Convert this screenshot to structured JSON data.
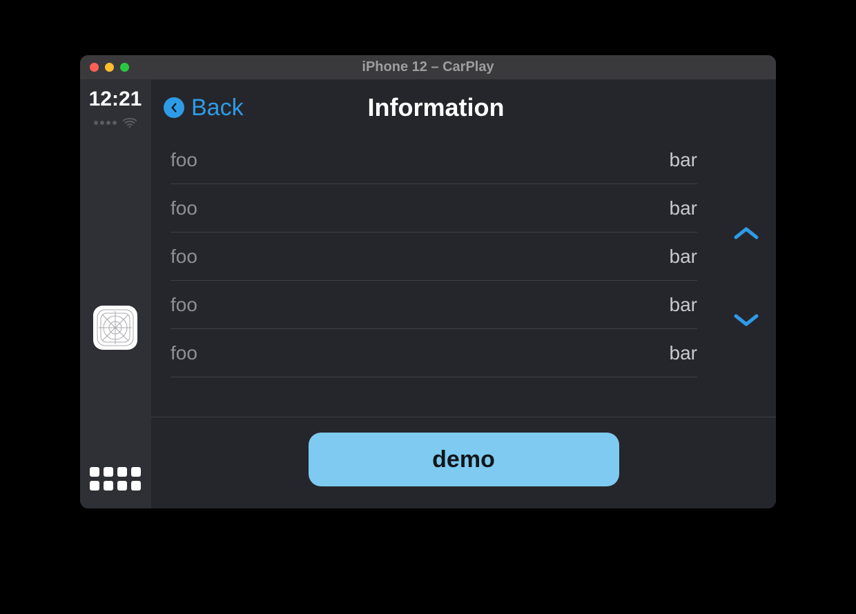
{
  "window": {
    "title": "iPhone 12 – CarPlay"
  },
  "status": {
    "time": "12:21"
  },
  "nav": {
    "back_label": "Back",
    "title": "Information"
  },
  "list": [
    {
      "key": "foo",
      "value": "bar"
    },
    {
      "key": "foo",
      "value": "bar"
    },
    {
      "key": "foo",
      "value": "bar"
    },
    {
      "key": "foo",
      "value": "bar"
    },
    {
      "key": "foo",
      "value": "bar"
    }
  ],
  "footer": {
    "button_label": "demo"
  },
  "colors": {
    "accent": "#2e9be6",
    "button_bg": "#7ecaf0"
  }
}
